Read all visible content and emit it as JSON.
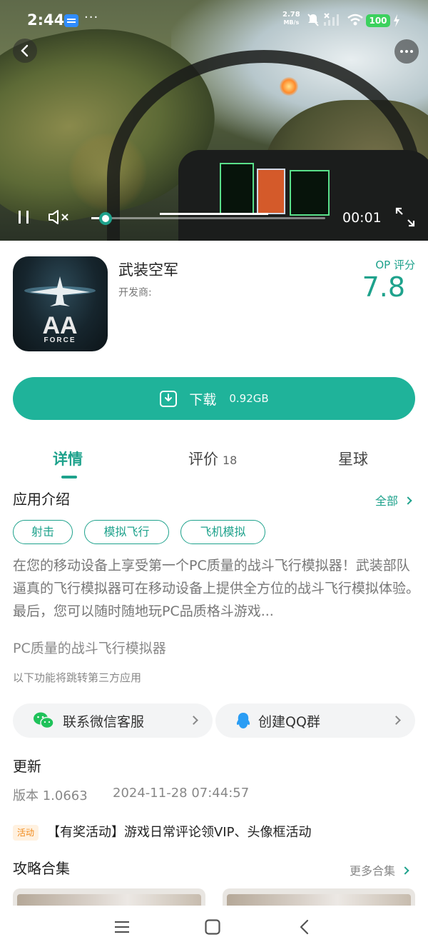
{
  "status_bar": {
    "time": "2:44",
    "more": "···",
    "net_speed_value": "2.78",
    "net_speed_unit": "MB/s",
    "battery": "100"
  },
  "video": {
    "current_time": "00:01",
    "progress_fraction": 0.06
  },
  "app": {
    "name": "武装空军",
    "developer_label": "开发商:",
    "score_label": "OP 评分",
    "score": "7.8",
    "icon_text_top": "AA",
    "icon_text_bottom": "FORCE"
  },
  "download": {
    "label": "下载",
    "size": "0.92GB"
  },
  "tabs": [
    {
      "label": "详情"
    },
    {
      "label": "评价",
      "count": "18"
    },
    {
      "label": "星球"
    }
  ],
  "intro": {
    "title": "应用介绍",
    "all_label": "全部",
    "tags": [
      "射击",
      "模拟飞行",
      "飞机模拟"
    ],
    "description": "在您的移动设备上享受第一个PC质量的战斗飞行模拟器！武装部队逼真的飞行模拟器可在移动设备上提供全方位的战斗飞行模拟体验。最后，您可以随时随地玩PC品质格斗游戏...",
    "subtitle": "PC质量的战斗飞行模拟器",
    "third_party_note": "以下功能将跳转第三方应用"
  },
  "contact": {
    "wechat_label": "联系微信客服",
    "qq_label": "创建QQ群"
  },
  "update": {
    "title": "更新",
    "version": "版本 1.0663",
    "date": "2024-11-28 07:44:57"
  },
  "activity": {
    "badge": "活动",
    "text": "【有奖活动】游戏日常评论领VIP、头像框活动"
  },
  "guides": {
    "title": "攻略合集",
    "more_label": "更多合集"
  },
  "colors": {
    "accent": "#1ea28c",
    "download_bg": "#1fb39a",
    "activity_badge": "#f08a1c"
  }
}
